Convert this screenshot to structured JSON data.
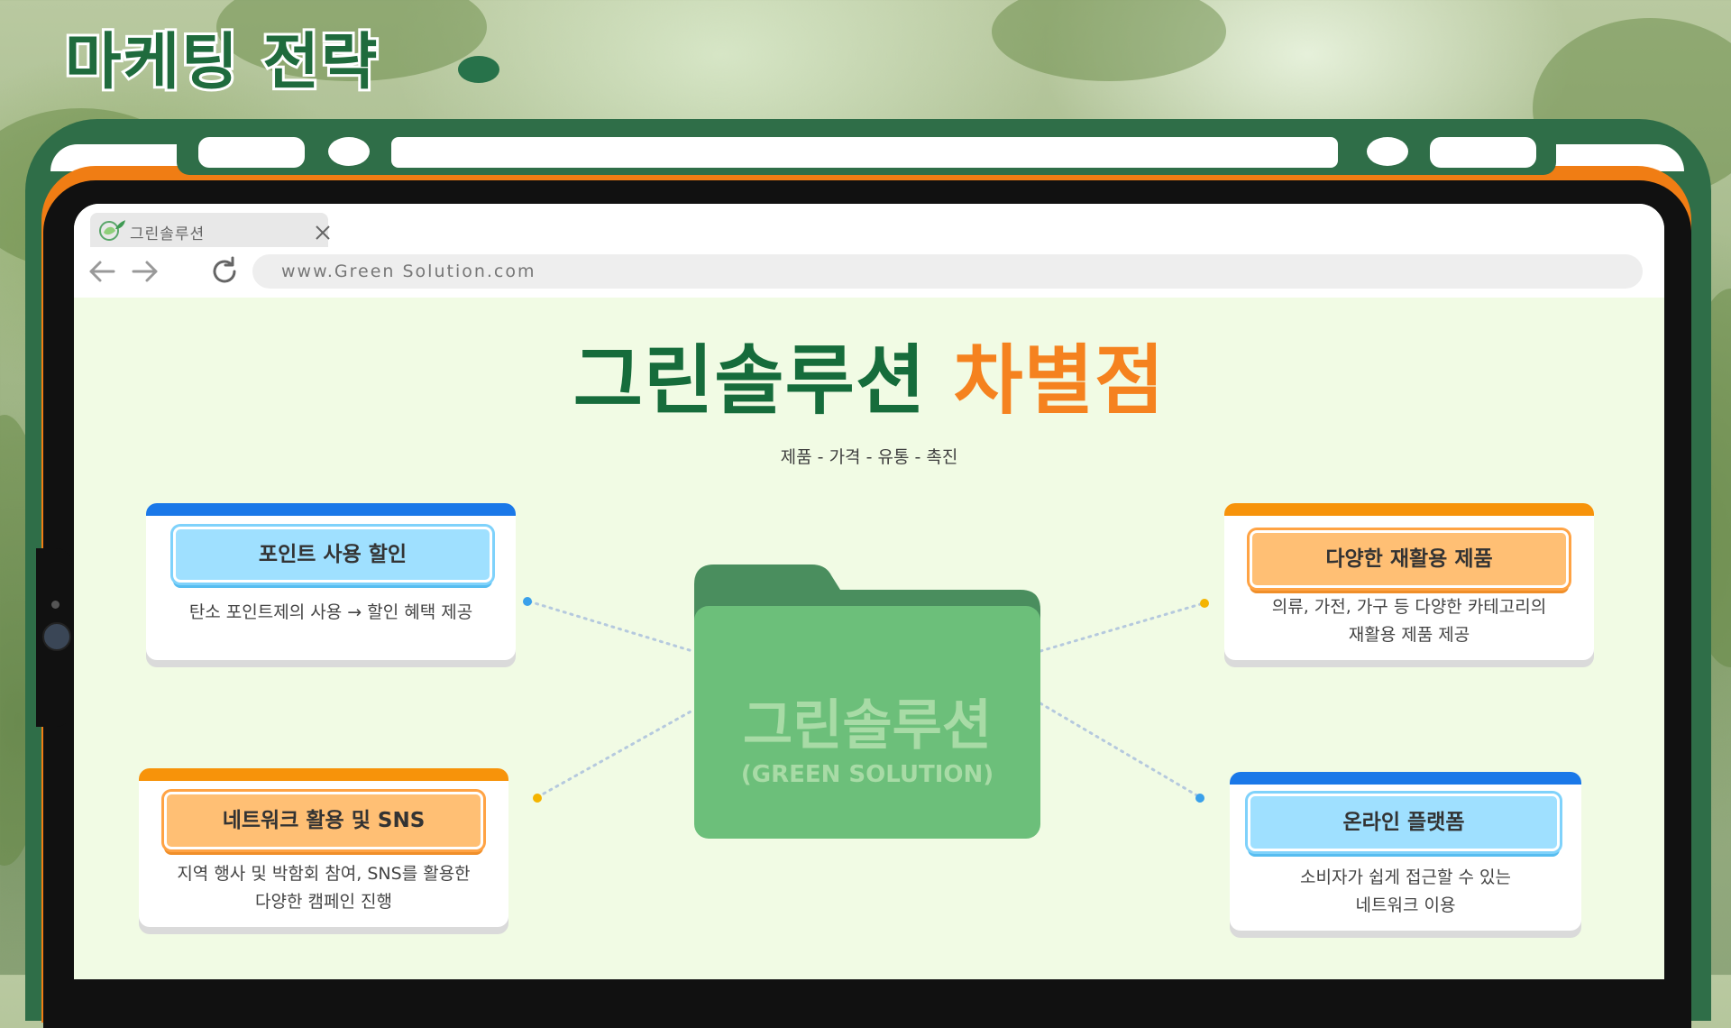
{
  "page": {
    "title": "마케팅 전략"
  },
  "browser": {
    "tab_label": "그린솔루션",
    "url": "www.Green Solution.com"
  },
  "content": {
    "heading_main": "그린솔루션",
    "heading_accent": "차별점",
    "subheading": "제품 - 가격 - 유통 - 촉진",
    "center_folder": {
      "title": "그린솔루션",
      "subtitle": "(GREEN SOLUTION)"
    },
    "cards": [
      {
        "label": "포인트 사용 할인",
        "desc_lines": [
          "탄소 포인트제의 사용 → 할인 혜택 제공"
        ],
        "accent": "blue"
      },
      {
        "label": "다양한 재활용 제품",
        "desc_lines": [
          "의류, 가전, 가구 등 다양한 카테고리의",
          "재활용 제품 제공"
        ],
        "accent": "orange"
      },
      {
        "label": "네트워크 활용 및 SNS",
        "desc_lines": [
          "지역 행사 및 박함회 참여, SNS를 활용한",
          "다양한 캠페인 진행"
        ],
        "accent": "orange"
      },
      {
        "label": "온라인 플랫폼",
        "desc_lines": [
          "소비자가 쉽게 접근할 수 있는",
          "네트워크 이용"
        ],
        "accent": "blue"
      }
    ]
  },
  "colors": {
    "dark_green": "#166c3b",
    "frame_green": "#2f6e48",
    "orange": "#f5821f",
    "blue_stripe": "#1a78e8",
    "orange_stripe": "#f7930a",
    "screen_bg": "#f1fbe4",
    "folder_green": "#6cbf7a"
  },
  "icons": [
    "back-arrow-icon",
    "forward-arrow-icon",
    "reload-icon",
    "close-icon",
    "leaf-logo-icon",
    "folder-icon"
  ]
}
